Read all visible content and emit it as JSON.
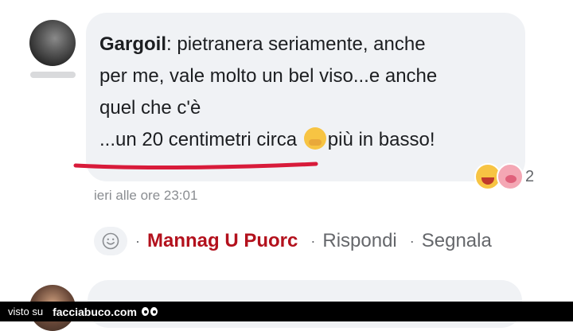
{
  "comment": {
    "author": "Gargoil",
    "separator": ":",
    "line1": " pietranera seriamente, anche",
    "line2": "per me, vale molto un bel viso...e anche",
    "line3": "quel che c'è",
    "line4_before": "...un 20 centimetri circa ",
    "line4_after": "più in basso!",
    "timestamp": "ieri alle ore 23:01",
    "reactions": {
      "icons": [
        "laughing-tears",
        "pig-face"
      ],
      "count": "2"
    }
  },
  "actions": {
    "dot": "·",
    "username": "Mannag U Puorc",
    "reply": "Rispondi",
    "report": "Segnala"
  },
  "footer": {
    "prefix": "visto su",
    "brand": "facciabuco.com"
  },
  "colors": {
    "bubble": "#f0f2f5",
    "username": "#b3111d",
    "underline": "#d81b3a",
    "meta": "#65676b"
  }
}
